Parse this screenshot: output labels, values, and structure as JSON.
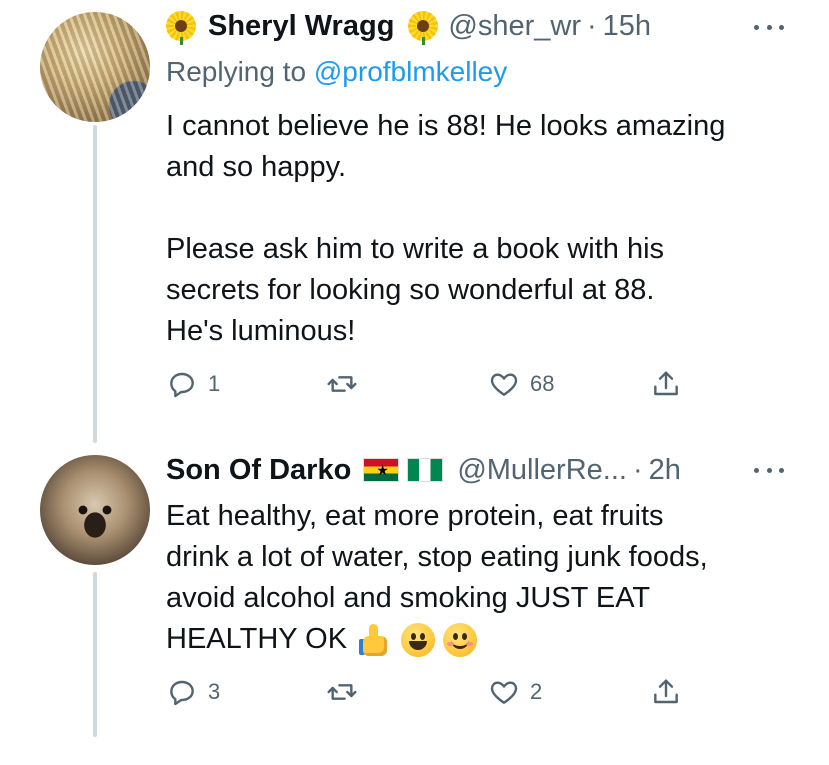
{
  "tweets": [
    {
      "display_name": "Sheryl Wragg",
      "name_emoji_left": "sunflower",
      "name_emoji_right": "sunflower",
      "handle": "@sher_wr",
      "separator": "·",
      "time": "15h",
      "replying_label": "Replying to",
      "replying_to": "@profblmkelley",
      "body_lines": [
        "I cannot believe he is 88! He looks amazing",
        "and so happy.",
        "",
        "Please ask him to write a book with his",
        "secrets for looking so wonderful at 88.",
        "He's luminous!"
      ],
      "actions": {
        "reply_count": "1",
        "retweet_count": "",
        "like_count": "68"
      }
    },
    {
      "display_name": "Son Of Darko",
      "name_flags": [
        "ghana-flag",
        "nigeria-flag"
      ],
      "handle": "@MullerRe...",
      "separator": "·",
      "time": "2h",
      "body_lines": [
        "Eat healthy, eat more protein, eat fruits",
        "drink a lot of water, stop eating junk foods,",
        "avoid alcohol and smoking JUST EAT",
        "HEALTHY OK"
      ],
      "body_emojis": [
        "thumbs-up",
        "grinning-face",
        "smiling-face"
      ],
      "actions": {
        "reply_count": "3",
        "retweet_count": "",
        "like_count": "2"
      }
    }
  ],
  "icons": {
    "reply": "reply-icon",
    "retweet": "retweet-icon",
    "like": "heart-icon",
    "share": "share-icon",
    "more": "more-icon"
  },
  "colors": {
    "text": "#0f1419",
    "secondary": "#536471",
    "link": "#1d9bf0",
    "thread_line": "#cfd9de"
  }
}
